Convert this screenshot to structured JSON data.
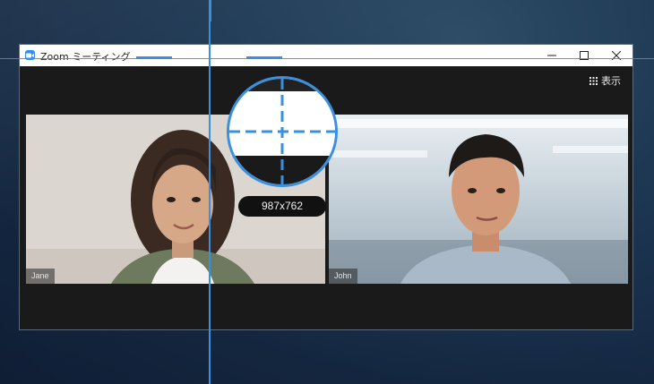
{
  "window": {
    "title": "Zoom ミーティング",
    "view_label": "表示"
  },
  "participants": [
    {
      "name": "Jane"
    },
    {
      "name": "John"
    }
  ],
  "overlay": {
    "size_readout": "987x762"
  },
  "colors": {
    "zoom_blue": "#2d8cff",
    "guide_blue": "#3a90e0",
    "meeting_bg": "#1a1a1a"
  },
  "icons": {
    "app": "zoom-camera-icon",
    "minimize": "minimize-icon",
    "maximize": "maximize-icon",
    "close": "close-icon",
    "view": "grid-icon"
  }
}
